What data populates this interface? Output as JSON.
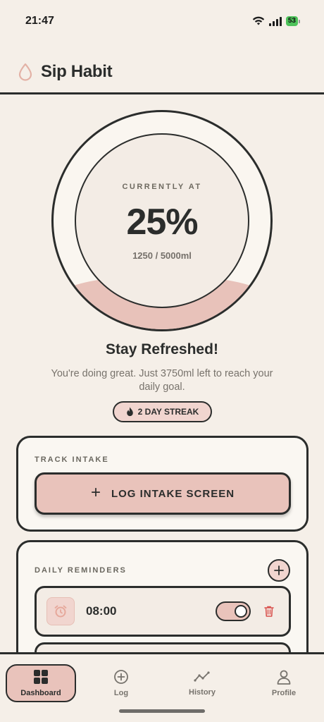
{
  "status_bar": {
    "time": "21:47",
    "battery": "53"
  },
  "header": {
    "app_title": "Sip Habit",
    "logo_icon": "water-drop-icon"
  },
  "progress": {
    "label": "CURRENTLY AT",
    "percent_text": "25%",
    "percent_value": 25,
    "amount_text": "1250 / 5000ml"
  },
  "motivation": {
    "title": "Stay Refreshed!",
    "message": "You're doing great. Just 3750ml left to reach your daily goal."
  },
  "streak": {
    "label": "2 DAY STREAK",
    "icon": "flame-icon"
  },
  "track_intake": {
    "label": "TRACK INTAKE",
    "button_label": "LOG INTAKE SCREEN"
  },
  "reminders": {
    "label": "DAILY REMINDERS",
    "items": [
      {
        "time": "08:00",
        "enabled": true
      }
    ]
  },
  "nav": {
    "items": [
      {
        "label": "Dashboard",
        "icon": "grid-icon",
        "active": true
      },
      {
        "label": "Log",
        "icon": "plus-circle-icon",
        "active": false
      },
      {
        "label": "History",
        "icon": "trend-line-icon",
        "active": false
      },
      {
        "label": "Profile",
        "icon": "user-icon",
        "active": false
      }
    ]
  },
  "colors": {
    "background": "#f5efe8",
    "accent": "#e9c3bb",
    "ink": "#2b2d2c",
    "danger": "#d9534f"
  }
}
